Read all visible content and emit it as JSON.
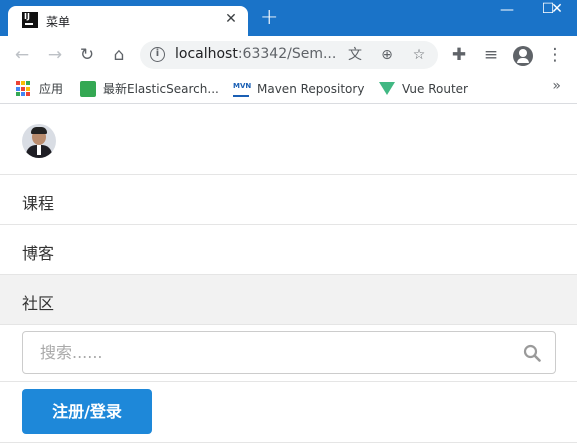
{
  "browser": {
    "tab_title": "菜单",
    "tab_close": "✕",
    "new_tab": "+",
    "url_host": "localhost",
    "url_rest": ":63342/Sem...",
    "window_controls": {
      "minimize": "—",
      "maximize": "☐",
      "close": "✕"
    }
  },
  "bookmarks": [
    {
      "label": "应用",
      "icon": "apps-grid-icon"
    },
    {
      "label": "最新ElasticSearch...",
      "icon": "elasticsearch-icon"
    },
    {
      "label": "Maven Repository",
      "icon": "maven-icon"
    },
    {
      "label": "Vue Router",
      "icon": "vue-icon"
    }
  ],
  "bookmarks_more": "»",
  "nav": {
    "items": [
      {
        "label": "课程"
      },
      {
        "label": "博客"
      },
      {
        "label": "社区",
        "active": true
      }
    ]
  },
  "search": {
    "placeholder": "搜索......",
    "value": ""
  },
  "login_button": "注册/登录",
  "colors": {
    "titlebar": "#1a73c8",
    "primary_button": "#1e88d9",
    "active_row": "#f2f2f2"
  }
}
